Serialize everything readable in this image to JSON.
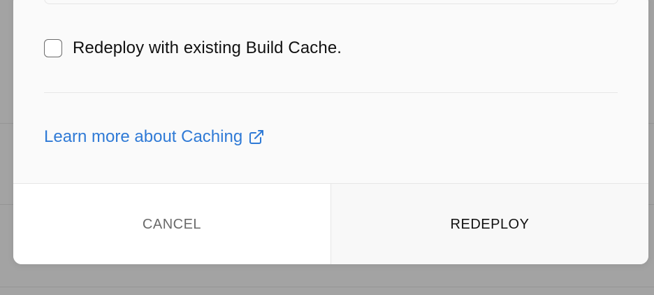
{
  "dialog": {
    "checkbox": {
      "label": "Redeploy with existing Build Cache.",
      "checked": false
    },
    "learn_more": {
      "text": "Learn more about Caching",
      "icon": "external-link-icon",
      "color": "#2f7ad6"
    },
    "actions": {
      "cancel_label": "CANCEL",
      "redeploy_label": "REDEPLOY"
    }
  }
}
